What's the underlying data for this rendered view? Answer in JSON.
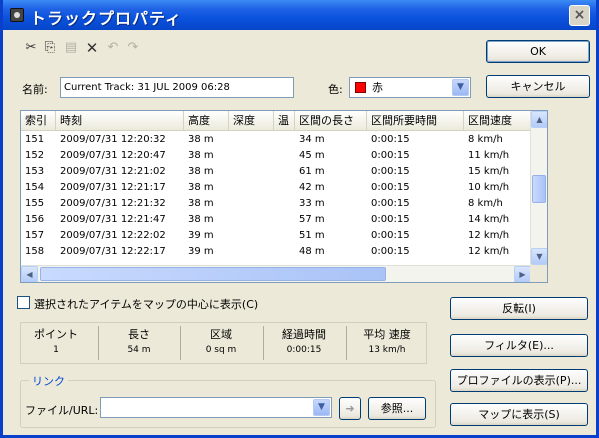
{
  "window": {
    "title": "トラックプロパティ",
    "close_label": "×"
  },
  "toolbar": {
    "cut_icon": "✂",
    "copy_icon": "⎘",
    "paste_icon": "▤",
    "delete_icon": "✕",
    "undo_icon": "↶",
    "redo_icon": "↷"
  },
  "buttons": {
    "ok": "OK",
    "cancel": "キャンセル",
    "reverse": "反転(I)",
    "filter": "フィルタ(E)...",
    "show_profile": "プロファイルの表示(P)...",
    "show_on_map": "マップに表示(S)",
    "browse": "参照..."
  },
  "form": {
    "name_label": "名前:",
    "name_value": "Current Track: 31 JUL 2009 06:28",
    "color_label": "色:",
    "color_value": "赤",
    "color_hex": "#ff0000"
  },
  "table": {
    "columns": [
      "索引",
      "時刻",
      "高度",
      "深度",
      "温",
      "区間の長さ",
      "区間所要時間",
      "区間速度"
    ],
    "rows": [
      [
        "151",
        "2009/07/31 12:20:32",
        "38 m",
        "",
        "",
        "34 m",
        "0:00:15",
        "8 km/h"
      ],
      [
        "152",
        "2009/07/31 12:20:47",
        "38 m",
        "",
        "",
        "45 m",
        "0:00:15",
        "11 km/h"
      ],
      [
        "153",
        "2009/07/31 12:21:02",
        "38 m",
        "",
        "",
        "61 m",
        "0:00:15",
        "15 km/h"
      ],
      [
        "154",
        "2009/07/31 12:21:17",
        "38 m",
        "",
        "",
        "42 m",
        "0:00:15",
        "10 km/h"
      ],
      [
        "155",
        "2009/07/31 12:21:32",
        "38 m",
        "",
        "",
        "33 m",
        "0:00:15",
        "8 km/h"
      ],
      [
        "156",
        "2009/07/31 12:21:47",
        "38 m",
        "",
        "",
        "57 m",
        "0:00:15",
        "14 km/h"
      ],
      [
        "157",
        "2009/07/31 12:22:02",
        "39 m",
        "",
        "",
        "51 m",
        "0:00:15",
        "12 km/h"
      ],
      [
        "158",
        "2009/07/31 12:22:17",
        "39 m",
        "",
        "",
        "48 m",
        "0:00:15",
        "12 km/h"
      ]
    ]
  },
  "center_option": {
    "label": "選択されたアイテムをマップの中心に表示(C)",
    "checked": false
  },
  "summary": {
    "point_label": "ポイント",
    "point_value": "1",
    "length_label": "長さ",
    "length_value": "54 m",
    "area_label": "区域",
    "area_value": "0 sq m",
    "elapsed_label": "経過時間",
    "elapsed_value": "0:00:15",
    "avg_speed_label": "平均 速度",
    "avg_speed_value": "13 km/h"
  },
  "link": {
    "group_label": "リンク",
    "file_url_label": "ファイル/URL:",
    "file_url_value": ""
  }
}
